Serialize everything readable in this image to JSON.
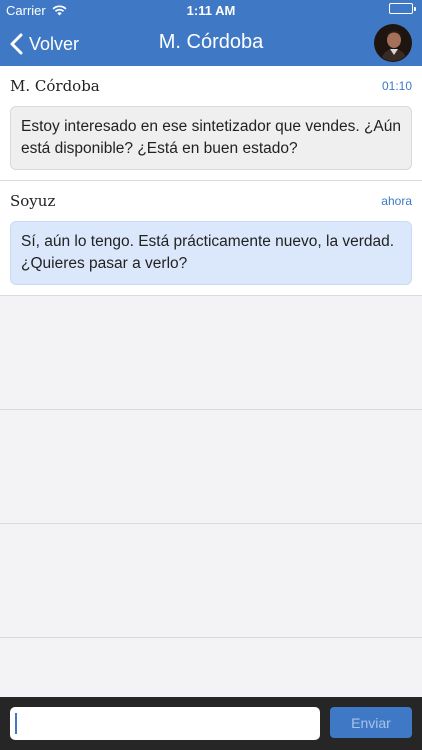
{
  "status_bar": {
    "carrier": "Carrier",
    "time": "1:11 AM"
  },
  "nav": {
    "back_label": "Volver",
    "title": "M. Córdoba"
  },
  "messages": [
    {
      "author": "M. Córdoba",
      "time": "01:10",
      "text": "Estoy interesado en ese sintetizador que vendes. ¿Aún está disponible? ¿Está en buen estado?",
      "style": "received"
    },
    {
      "author": "Soyuz",
      "time": "ahora",
      "text": "Sí, aún lo tengo. Está prácticamente nuevo, la verdad. ¿Quieres pasar a verlo?",
      "style": "sent"
    }
  ],
  "compose": {
    "value": "",
    "send_label": "Enviar"
  },
  "colors": {
    "accent": "#3f79c6",
    "received_bubble": "#efefef",
    "sent_bubble": "#dbe8fb",
    "compose_bar": "#262626"
  }
}
